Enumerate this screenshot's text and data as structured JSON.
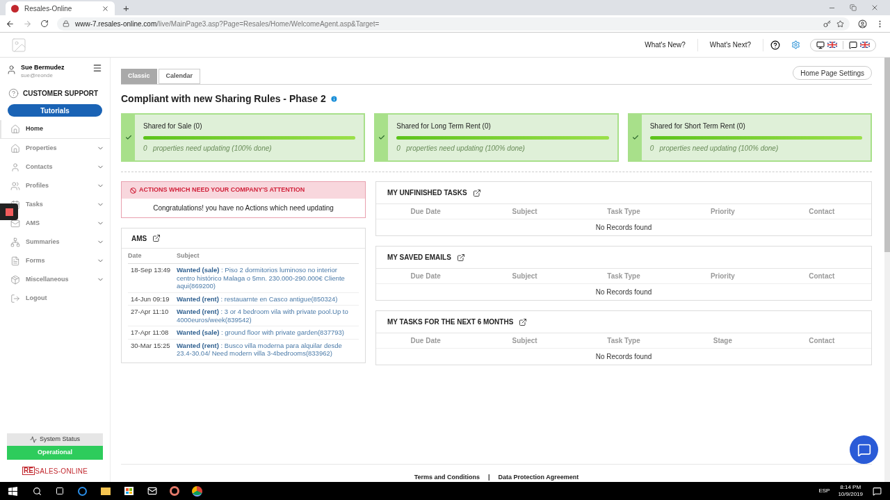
{
  "browser": {
    "tab_title": "Resales-Online",
    "new_tab": "+",
    "url_host": "www-7.resales-online.com",
    "url_path": "/live/MainPage3.asp?Page=Resales/Home/WelcomeAgent.asp&Target="
  },
  "header": {
    "links": [
      "What's New?",
      "What's Next?"
    ]
  },
  "user": {
    "name": "Sue Bermudez",
    "email": "sue@reonde"
  },
  "support": {
    "title": "CUSTOMER SUPPORT",
    "tutorials": "Tutorials"
  },
  "nav": [
    {
      "label": "Home",
      "selected": true,
      "expandable": false
    },
    {
      "label": "Properties",
      "selected": false,
      "expandable": true
    },
    {
      "label": "Contacts",
      "selected": false,
      "expandable": true
    },
    {
      "label": "Profiles",
      "selected": false,
      "expandable": true
    },
    {
      "label": "Tasks",
      "selected": false,
      "expandable": true
    },
    {
      "label": "AMS",
      "selected": false,
      "expandable": true
    },
    {
      "label": "Summaries",
      "selected": false,
      "expandable": true
    },
    {
      "label": "Forms",
      "selected": false,
      "expandable": true
    },
    {
      "label": "Miscellaneous",
      "selected": false,
      "expandable": true
    },
    {
      "label": "Logout",
      "selected": false,
      "expandable": false
    }
  ],
  "system_status": {
    "label": "System Status",
    "status": "Operational"
  },
  "brand": {
    "mark": "RE",
    "rest": "SALES-ONLINE"
  },
  "tabs": [
    {
      "label": "Classic",
      "selected": true
    },
    {
      "label": "Calendar",
      "selected": false
    }
  ],
  "settings_button": "Home Page Settings",
  "heading": "Compliant with new Sharing Rules - Phase 2",
  "sharing": [
    {
      "title": "Shared for Sale (0)",
      "level": 1,
      "count": "0",
      "note": "properties need updating (100% done)"
    },
    {
      "title": "Shared for Long Term Rent (0)",
      "level": 1,
      "count": "0",
      "note": "properties need updating (100% done)"
    },
    {
      "title": "Shared for Short Term Rent (0)",
      "level": 1,
      "count": "0",
      "note": "properties need updating (100% done)"
    }
  ],
  "actions": {
    "title": "ACTIONS WHICH NEED YOUR COMPANY'S ATTENTION",
    "message": "Congratulations! you have no Actions which need updating"
  },
  "ams": {
    "title": "AMS",
    "columns": [
      "Date",
      "Subject"
    ],
    "rows": [
      {
        "date": "18-Sep 13:49",
        "tag": "Wanted (sale)",
        "text": ": Piso 2 dormitorios luminoso no interior centro histórico Malaga o 5mn. 230.000-290.000€ Cliente aqui(869200)"
      },
      {
        "date": "14-Jun 09:19",
        "tag": "Wanted (rent)",
        "text": ": restauarnte en Casco antigue(850324)"
      },
      {
        "date": "27-Apr 11:10",
        "tag": "Wanted (rent)",
        "text": ": 3 or 4 bedroom vila with private pool.Up to 4000euros/week(839542)"
      },
      {
        "date": "17-Apr 11:08",
        "tag": "Wanted (sale)",
        "text": ": ground floor with private garden(837793)"
      },
      {
        "date": "30-Mar 15:25",
        "tag": "Wanted (rent)",
        "text": ": Busco villa moderna para alquilar desde 23.4-30.04/ Need modern villa 3-4bedrooms(833962)"
      }
    ]
  },
  "panels": [
    {
      "title": "MY UNFINISHED TASKS",
      "columns": [
        "Due Date",
        "Subject",
        "Task Type",
        "Priority",
        "Contact"
      ],
      "empty": "No Records found"
    },
    {
      "title": "MY SAVED EMAILS",
      "columns": [
        "Due Date",
        "Subject",
        "Task Type",
        "Priority",
        "Contact"
      ],
      "empty": "No Records found"
    },
    {
      "title": "MY TASKS FOR THE NEXT 6 MONTHS",
      "columns": [
        "Due Date",
        "Subject",
        "Task Type",
        "Stage",
        "Contact"
      ],
      "empty": "No Records found"
    }
  ],
  "footer": {
    "links": [
      "Terms and Conditions",
      "Data Protection Agreement"
    ],
    "separator": "|"
  },
  "taskbar": {
    "language": "ESP",
    "time": "8:14 PM",
    "date": "10/9/2019"
  }
}
